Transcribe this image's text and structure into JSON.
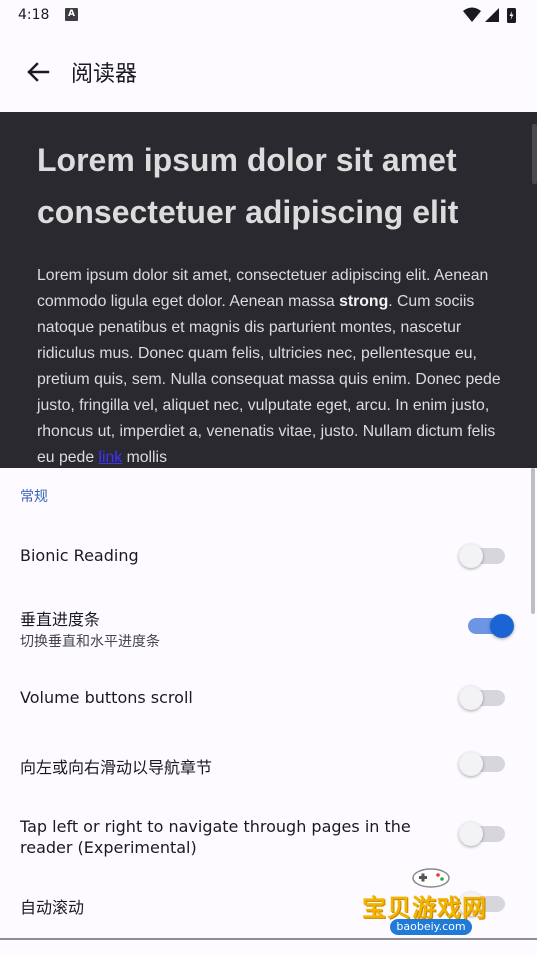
{
  "status": {
    "time": "4:18",
    "notif_letter": "A"
  },
  "app_bar": {
    "title": "阅读器"
  },
  "preview": {
    "heading": "Lorem ipsum dolor sit amet consectetuer adipiscing elit",
    "body_before_strong": "Lorem ipsum dolor sit amet, consectetuer adipiscing elit. Aenean commodo ligula eget dolor. Aenean massa ",
    "body_strong": "strong",
    "body_after_strong": ". Cum sociis natoque penatibus et magnis dis parturient montes, nascetur ridiculus mus. Donec quam felis, ultricies nec, pellentesque eu, pretium quis, sem. Nulla consequat massa quis enim. Donec pede justo, fringilla vel, aliquet nec, vulputate eget, arcu. In enim justo, rhoncus ut, imperdiet a, venenatis vitae, justo. Nullam dictum felis eu pede ",
    "body_link": "link",
    "body_end": " mollis"
  },
  "settings": {
    "section_title": "常规",
    "rows": [
      {
        "label": "Bionic Reading",
        "enabled": false
      },
      {
        "label": "垂直进度条",
        "sublabel": "切换垂直和水平进度条",
        "enabled": true
      },
      {
        "label": "Volume buttons scroll",
        "enabled": false
      },
      {
        "label": "向左或向右滑动以导航章节",
        "enabled": false
      },
      {
        "label": "Tap left or right to navigate through pages in the reader (Experimental)",
        "enabled": false
      },
      {
        "label": "自动滚动",
        "enabled": false
      }
    ]
  },
  "watermark": {
    "text": "宝贝游戏网",
    "url": "baobeiy.com"
  },
  "colors": {
    "accent": "#1b64d6",
    "preview_bg": "#2a2930",
    "section_header": "#3a63b8"
  }
}
